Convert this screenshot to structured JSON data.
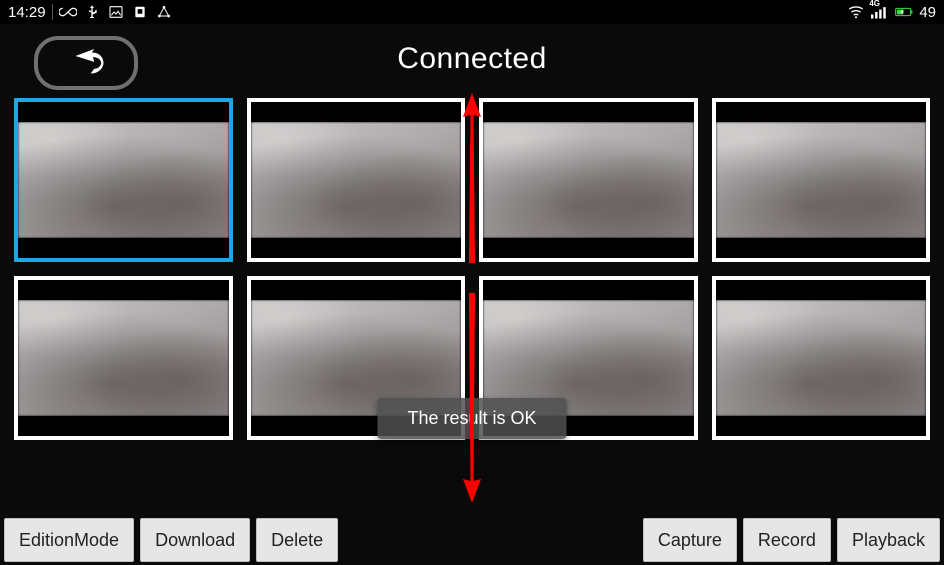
{
  "status_bar": {
    "time": "14:29",
    "battery": "49"
  },
  "header": {
    "title": "Connected"
  },
  "grid": {
    "rows": 2,
    "cols": 4,
    "selected_index": 0
  },
  "toast": {
    "message": "The result is OK"
  },
  "buttons": {
    "left": [
      {
        "label": "EditionMode"
      },
      {
        "label": "Download"
      },
      {
        "label": "Delete"
      }
    ],
    "right": [
      {
        "label": "Capture"
      },
      {
        "label": "Record"
      },
      {
        "label": "Playback"
      }
    ]
  },
  "colors": {
    "selection": "#1ea7e6",
    "annotation": "#ff0000"
  }
}
